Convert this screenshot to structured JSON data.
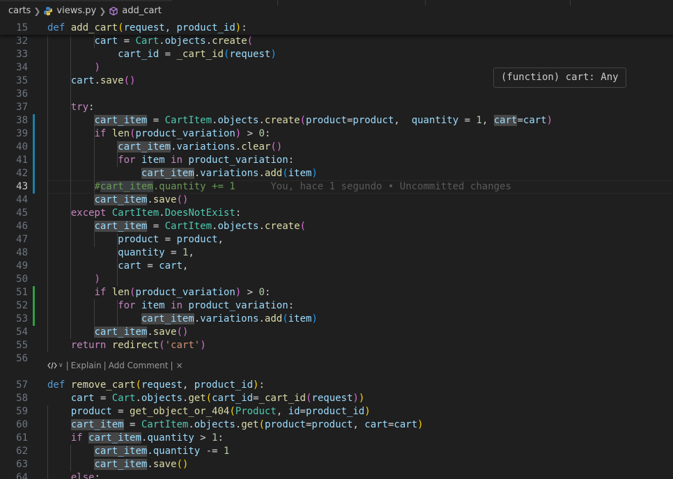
{
  "breadcrumb": {
    "folder": "carts",
    "file": "views.py",
    "symbol": "add_cart"
  },
  "sticky": {
    "line_number": "15",
    "def_kw": "def",
    "name": "add_cart",
    "open": "(",
    "params": "request, product_id",
    "close": ")",
    "colon": ":"
  },
  "tooltip": {
    "text": "(function) cart: Any"
  },
  "codelens": {
    "explain": "Explain",
    "add_comment": "Add Comment",
    "close": "×",
    "sep": "|"
  },
  "blame": {
    "text": "You, hace 1 segundo • Uncommitted changes"
  },
  "lines": [
    {
      "n": "32",
      "t": [
        [
          "    ",
          ""
        ],
        [
          "    ",
          ""
        ],
        [
          "cart",
          "vr"
        ],
        [
          " = ",
          "pn"
        ],
        [
          "Cart",
          "cl"
        ],
        [
          ".",
          "pn"
        ],
        [
          "objects",
          "vr"
        ],
        [
          ".",
          "pn"
        ],
        [
          "create",
          "fn"
        ],
        [
          "(",
          "p2"
        ]
      ]
    },
    {
      "n": "33",
      "t": [
        [
          "            ",
          ""
        ],
        [
          "cart_id",
          "vr"
        ],
        [
          " = ",
          "pn"
        ],
        [
          "_cart_id",
          "fn"
        ],
        [
          "(",
          "p3"
        ],
        [
          "request",
          "vr"
        ],
        [
          ")",
          "p3"
        ]
      ]
    },
    {
      "n": "34",
      "t": [
        [
          "        ",
          ""
        ],
        [
          ")",
          "p2"
        ]
      ]
    },
    {
      "n": "35",
      "t": [
        [
          "    ",
          ""
        ],
        [
          "cart",
          "vr"
        ],
        [
          ".",
          "pn"
        ],
        [
          "save",
          "fn"
        ],
        [
          "(",
          "p2"
        ],
        [
          ")",
          "p2"
        ]
      ]
    },
    {
      "n": "36",
      "t": []
    },
    {
      "n": "37",
      "t": [
        [
          "    ",
          ""
        ],
        [
          "try",
          "kc"
        ],
        [
          ":",
          "pn"
        ]
      ]
    },
    {
      "n": "38",
      "t": [
        [
          "        ",
          ""
        ],
        [
          "cart_item",
          "vr hl"
        ],
        [
          " = ",
          "pn"
        ],
        [
          "CartItem",
          "cl"
        ],
        [
          ".",
          "pn"
        ],
        [
          "objects",
          "vr"
        ],
        [
          ".",
          "pn"
        ],
        [
          "create",
          "fn"
        ],
        [
          "(",
          "p2"
        ],
        [
          "product",
          "vr"
        ],
        [
          "=",
          "pn"
        ],
        [
          "product",
          "vr"
        ],
        [
          ",  ",
          "pn"
        ],
        [
          "quantity",
          "vr"
        ],
        [
          " = ",
          "pn"
        ],
        [
          "1",
          "nm"
        ],
        [
          ", ",
          "pn"
        ],
        [
          "cart",
          "vr hl"
        ],
        [
          "=",
          "pn"
        ],
        [
          "cart",
          "vr"
        ],
        [
          ")",
          "p2"
        ]
      ]
    },
    {
      "n": "39",
      "t": [
        [
          "        ",
          ""
        ],
        [
          "if ",
          "kc"
        ],
        [
          "len",
          "fn"
        ],
        [
          "(",
          "p2"
        ],
        [
          "product_variation",
          "vr"
        ],
        [
          ")",
          "p2"
        ],
        [
          " > ",
          "pn"
        ],
        [
          "0",
          "nm"
        ],
        [
          ":",
          "pn"
        ]
      ]
    },
    {
      "n": "40",
      "t": [
        [
          "            ",
          ""
        ],
        [
          "cart_item",
          "vr hl"
        ],
        [
          ".",
          "pn"
        ],
        [
          "variations",
          "vr"
        ],
        [
          ".",
          "pn"
        ],
        [
          "clear",
          "fn"
        ],
        [
          "(",
          "p2"
        ],
        [
          ")",
          "p2"
        ]
      ]
    },
    {
      "n": "41",
      "t": [
        [
          "            ",
          ""
        ],
        [
          "for ",
          "kc"
        ],
        [
          "item ",
          "vr"
        ],
        [
          "in ",
          "kc"
        ],
        [
          "product_variation",
          "vr"
        ],
        [
          ":",
          "pn"
        ]
      ]
    },
    {
      "n": "42",
      "t": [
        [
          "                ",
          ""
        ],
        [
          "cart_item",
          "vr hl"
        ],
        [
          ".",
          "pn"
        ],
        [
          "variations",
          "vr"
        ],
        [
          ".",
          "pn"
        ],
        [
          "add",
          "fn"
        ],
        [
          "(",
          "p3"
        ],
        [
          "item",
          "vr"
        ],
        [
          ")",
          "p3"
        ]
      ]
    },
    {
      "n": "43",
      "t": [
        [
          "        ",
          ""
        ],
        [
          "#",
          "cm"
        ],
        [
          "cart_item",
          "cm hl-cm"
        ],
        [
          ".quantity += 1",
          "cm"
        ],
        [
          "      ",
          ""
        ],
        [
          "You, hace 1 segundo • Uncommitted changes",
          "blame"
        ]
      ]
    },
    {
      "n": "44",
      "t": [
        [
          "        ",
          ""
        ],
        [
          "cart_item",
          "vr hl"
        ],
        [
          ".",
          "pn"
        ],
        [
          "save",
          "fn"
        ],
        [
          "(",
          "p2"
        ],
        [
          ")",
          "p2"
        ]
      ]
    },
    {
      "n": "45",
      "t": [
        [
          "    ",
          ""
        ],
        [
          "except ",
          "kc"
        ],
        [
          "CartItem",
          "cl"
        ],
        [
          ".",
          "pn"
        ],
        [
          "DoesNotExist",
          "cl"
        ],
        [
          ":",
          "pn"
        ]
      ]
    },
    {
      "n": "46",
      "t": [
        [
          "        ",
          ""
        ],
        [
          "cart_item",
          "vr hl"
        ],
        [
          " = ",
          "pn"
        ],
        [
          "CartItem",
          "cl"
        ],
        [
          ".",
          "pn"
        ],
        [
          "objects",
          "vr"
        ],
        [
          ".",
          "pn"
        ],
        [
          "create",
          "fn"
        ],
        [
          "(",
          "p2"
        ]
      ]
    },
    {
      "n": "47",
      "t": [
        [
          "            ",
          ""
        ],
        [
          "product",
          "vr"
        ],
        [
          " = ",
          "pn"
        ],
        [
          "product",
          "vr"
        ],
        [
          ",",
          "pn"
        ]
      ]
    },
    {
      "n": "48",
      "t": [
        [
          "            ",
          ""
        ],
        [
          "quantity",
          "vr"
        ],
        [
          " = ",
          "pn"
        ],
        [
          "1",
          "nm"
        ],
        [
          ",",
          "pn"
        ]
      ]
    },
    {
      "n": "49",
      "t": [
        [
          "            ",
          ""
        ],
        [
          "cart",
          "vr"
        ],
        [
          " = ",
          "pn"
        ],
        [
          "cart",
          "vr"
        ],
        [
          ",",
          "pn"
        ]
      ]
    },
    {
      "n": "50",
      "t": [
        [
          "        ",
          ""
        ],
        [
          ")",
          "p2"
        ]
      ]
    },
    {
      "n": "51",
      "t": [
        [
          "        ",
          ""
        ],
        [
          "if ",
          "kc"
        ],
        [
          "len",
          "fn"
        ],
        [
          "(",
          "p2"
        ],
        [
          "product_variation",
          "vr"
        ],
        [
          ")",
          "p2"
        ],
        [
          " > ",
          "pn"
        ],
        [
          "0",
          "nm"
        ],
        [
          ":",
          "pn"
        ]
      ]
    },
    {
      "n": "52",
      "t": [
        [
          "            ",
          ""
        ],
        [
          "for ",
          "kc"
        ],
        [
          "item ",
          "vr"
        ],
        [
          "in ",
          "kc"
        ],
        [
          "product_variation",
          "vr"
        ],
        [
          ":",
          "pn"
        ]
      ]
    },
    {
      "n": "53",
      "t": [
        [
          "                ",
          ""
        ],
        [
          "cart_item",
          "vr hl"
        ],
        [
          ".",
          "pn"
        ],
        [
          "variations",
          "vr"
        ],
        [
          ".",
          "pn"
        ],
        [
          "add",
          "fn"
        ],
        [
          "(",
          "p3"
        ],
        [
          "item",
          "vr"
        ],
        [
          ")",
          "p3"
        ]
      ]
    },
    {
      "n": "54",
      "t": [
        [
          "        ",
          ""
        ],
        [
          "cart_item",
          "vr hl"
        ],
        [
          ".",
          "pn"
        ],
        [
          "save",
          "fn"
        ],
        [
          "(",
          "p2"
        ],
        [
          ")",
          "p2"
        ]
      ]
    },
    {
      "n": "55",
      "t": [
        [
          "    ",
          ""
        ],
        [
          "return ",
          "kc"
        ],
        [
          "redirect",
          "fn"
        ],
        [
          "(",
          "p2"
        ],
        [
          "'cart'",
          "st"
        ],
        [
          ")",
          "p2"
        ]
      ]
    },
    {
      "n": "56",
      "t": []
    },
    {
      "n": "57",
      "t": [
        [
          "def ",
          "kw"
        ],
        [
          "remove_cart",
          "fn"
        ],
        [
          "(",
          "p1"
        ],
        [
          "request",
          "vr"
        ],
        [
          ", ",
          "pn"
        ],
        [
          "product_id",
          "vr"
        ],
        [
          ")",
          "p1"
        ],
        [
          ":",
          "pn"
        ]
      ]
    },
    {
      "n": "58",
      "t": [
        [
          "    ",
          ""
        ],
        [
          "cart",
          "vr"
        ],
        [
          " = ",
          "pn"
        ],
        [
          "Cart",
          "cl"
        ],
        [
          ".",
          "pn"
        ],
        [
          "objects",
          "vr"
        ],
        [
          ".",
          "pn"
        ],
        [
          "get",
          "fn"
        ],
        [
          "(",
          "p1"
        ],
        [
          "cart_id",
          "vr"
        ],
        [
          "=",
          "pn"
        ],
        [
          "_cart_id",
          "fn"
        ],
        [
          "(",
          "p2"
        ],
        [
          "request",
          "vr"
        ],
        [
          ")",
          "p2"
        ],
        [
          ")",
          "p1"
        ]
      ]
    },
    {
      "n": "59",
      "t": [
        [
          "    ",
          ""
        ],
        [
          "product",
          "vr"
        ],
        [
          " = ",
          "pn"
        ],
        [
          "get_object_or_404",
          "fn"
        ],
        [
          "(",
          "p1"
        ],
        [
          "Product",
          "cl"
        ],
        [
          ", ",
          "pn"
        ],
        [
          "id",
          "vr"
        ],
        [
          "=",
          "pn"
        ],
        [
          "product_id",
          "vr"
        ],
        [
          ")",
          "p1"
        ]
      ]
    },
    {
      "n": "60",
      "t": [
        [
          "    ",
          ""
        ],
        [
          "cart_item",
          "vr hl"
        ],
        [
          " = ",
          "pn"
        ],
        [
          "CartItem",
          "cl"
        ],
        [
          ".",
          "pn"
        ],
        [
          "objects",
          "vr"
        ],
        [
          ".",
          "pn"
        ],
        [
          "get",
          "fn"
        ],
        [
          "(",
          "p1"
        ],
        [
          "product",
          "vr"
        ],
        [
          "=",
          "pn"
        ],
        [
          "product",
          "vr"
        ],
        [
          ", ",
          "pn"
        ],
        [
          "cart",
          "vr"
        ],
        [
          "=",
          "pn"
        ],
        [
          "cart",
          "vr"
        ],
        [
          ")",
          "p1"
        ]
      ]
    },
    {
      "n": "61",
      "t": [
        [
          "    ",
          ""
        ],
        [
          "if ",
          "kc"
        ],
        [
          "cart_item",
          "vr hl"
        ],
        [
          ".",
          "pn"
        ],
        [
          "quantity",
          "vr"
        ],
        [
          " > ",
          "pn"
        ],
        [
          "1",
          "nm"
        ],
        [
          ":",
          "pn"
        ]
      ]
    },
    {
      "n": "62",
      "t": [
        [
          "        ",
          ""
        ],
        [
          "cart_item",
          "vr hl"
        ],
        [
          ".",
          "pn"
        ],
        [
          "quantity",
          "vr"
        ],
        [
          " -= ",
          "pn"
        ],
        [
          "1",
          "nm"
        ]
      ]
    },
    {
      "n": "63",
      "t": [
        [
          "        ",
          ""
        ],
        [
          "cart_item",
          "vr hl"
        ],
        [
          ".",
          "pn"
        ],
        [
          "save",
          "fn"
        ],
        [
          "(",
          "p1"
        ],
        [
          ")",
          "p1"
        ]
      ]
    },
    {
      "n": "64",
      "t": [
        [
          "    ",
          ""
        ],
        [
          "else",
          "kc"
        ],
        [
          ":",
          "pn"
        ]
      ]
    }
  ],
  "active_line": "43",
  "colors": {
    "background": "#1f1f1f",
    "line_number": "#6e7681",
    "modified_gutter": "#1b81a8",
    "added_gutter": "#2ea043"
  }
}
